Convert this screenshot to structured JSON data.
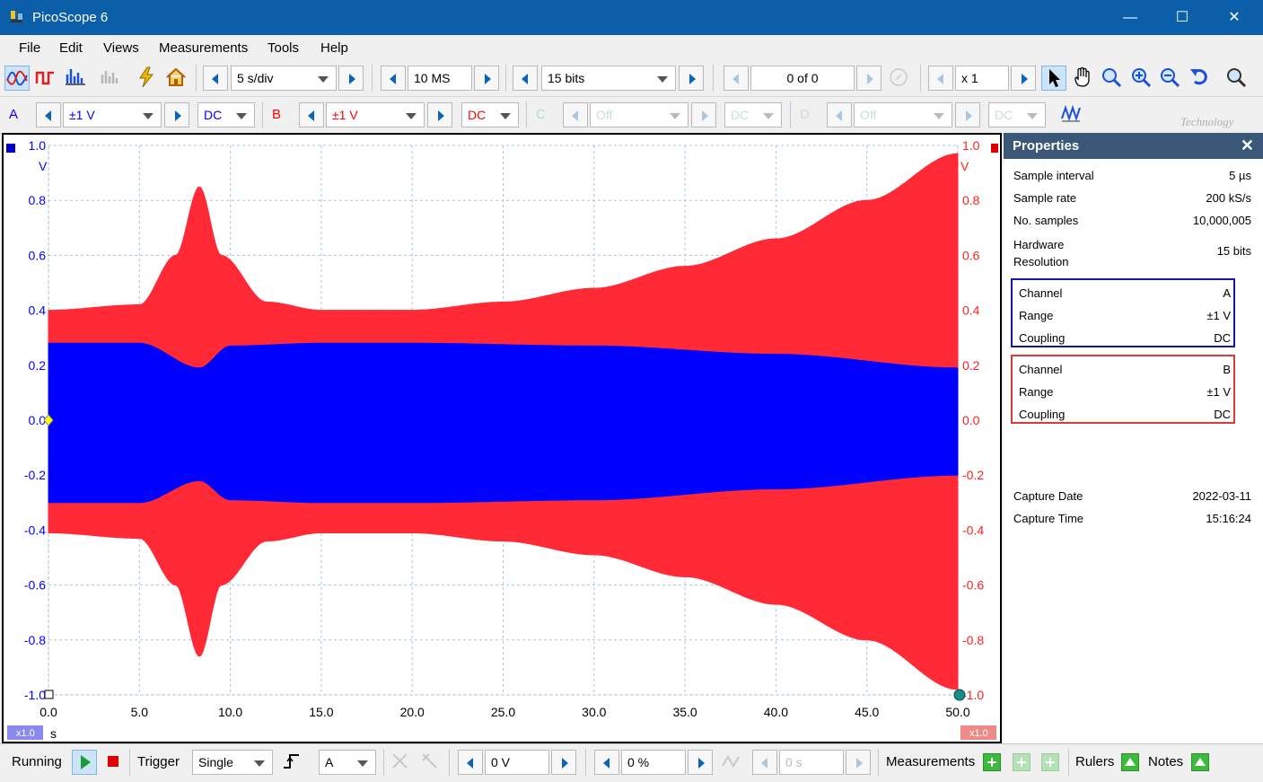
{
  "window": {
    "title": "PicoScope 6"
  },
  "menu": [
    "File",
    "Edit",
    "Views",
    "Measurements",
    "Tools",
    "Help"
  ],
  "toolbar1": {
    "timebase": "5 s/div",
    "samples": "10 MS",
    "resolution": "15 bits",
    "buffer": "0 of 0",
    "zoom": "x 1"
  },
  "toolbar2": {
    "channels": [
      {
        "label": "A",
        "range": "±1 V",
        "coupling": "DC",
        "color": "#0000ff",
        "enabled": true
      },
      {
        "label": "B",
        "range": "±1 V",
        "coupling": "DC",
        "color": "#ff0000",
        "enabled": true
      },
      {
        "label": "C",
        "range": "Off",
        "coupling": "DC",
        "color": "#9fd5c8",
        "enabled": false
      },
      {
        "label": "D",
        "range": "Off",
        "coupling": "DC",
        "color": "#d9c4a0",
        "enabled": false
      }
    ],
    "brand_text": "Technology"
  },
  "scope": {
    "left_axis_unit": "V",
    "right_axis_unit": "V",
    "x_unit": "s",
    "left_zoom_badge": "x1.0",
    "right_zoom_badge": "x1.0",
    "colors": {
      "A": "#0000ff",
      "B": "#ff2a35",
      "grid": "#a9c6de"
    }
  },
  "chart_data": {
    "type": "area",
    "xlim": [
      0,
      50
    ],
    "ylim": [
      -1,
      1
    ],
    "x_ticks": [
      "0.0",
      "5.0",
      "10.0",
      "15.0",
      "20.0",
      "25.0",
      "30.0",
      "35.0",
      "40.0",
      "45.0",
      "50.0"
    ],
    "y_ticks_left": [
      "1.0",
      "0.8",
      "0.6",
      "0.4",
      "0.2",
      "0.0",
      "-0.2",
      "-0.4",
      "-0.6",
      "-0.8",
      "-1.0"
    ],
    "y_ticks_right": [
      "1.0",
      "0.8",
      "0.6",
      "0.4",
      "0.2",
      "0.0",
      "-0.2",
      "-0.4",
      "-0.6",
      "-0.8",
      "-1.0"
    ],
    "grid": true,
    "series": [
      {
        "name": "A",
        "x": [
          0,
          5,
          8.3,
          10,
          15,
          20,
          30,
          40,
          50
        ],
        "upper": [
          0.28,
          0.28,
          0.19,
          0.27,
          0.28,
          0.28,
          0.27,
          0.24,
          0.19
        ],
        "lower": [
          -0.3,
          -0.3,
          -0.22,
          -0.29,
          -0.3,
          -0.3,
          -0.29,
          -0.25,
          -0.2
        ]
      },
      {
        "name": "B",
        "x": [
          0,
          5,
          7,
          8.3,
          9.5,
          12,
          15,
          20,
          25,
          30,
          35,
          40,
          45,
          50
        ],
        "upper": [
          0.4,
          0.42,
          0.6,
          0.85,
          0.6,
          0.43,
          0.4,
          0.4,
          0.43,
          0.48,
          0.56,
          0.66,
          0.8,
          0.97
        ],
        "lower": [
          -0.41,
          -0.43,
          -0.6,
          -0.86,
          -0.6,
          -0.44,
          -0.41,
          -0.41,
          -0.44,
          -0.49,
          -0.57,
          -0.67,
          -0.8,
          -0.98
        ]
      }
    ]
  },
  "properties": {
    "title": "Properties",
    "rows": [
      {
        "label": "Sample interval",
        "value": "5 µs"
      },
      {
        "label": "Sample rate",
        "value": "200 kS/s"
      },
      {
        "label": "No. samples",
        "value": "10,000,005"
      },
      {
        "label": "Hardware\nResolution",
        "value": "15 bits"
      }
    ],
    "channel_a": {
      "color": "#1515a8",
      "rows": [
        {
          "label": "Channel",
          "value": "A"
        },
        {
          "label": "Range",
          "value": "±1 V"
        },
        {
          "label": "Coupling",
          "value": "DC"
        }
      ]
    },
    "channel_b": {
      "color": "#d93a3a",
      "rows": [
        {
          "label": "Channel",
          "value": "B"
        },
        {
          "label": "Range",
          "value": "±1 V"
        },
        {
          "label": "Coupling",
          "value": "DC"
        }
      ]
    },
    "capture": [
      {
        "label": "Capture Date",
        "value": "2022-03-11"
      },
      {
        "label": "Capture Time",
        "value": "15:16:24"
      }
    ]
  },
  "status": {
    "running": "Running",
    "trigger_label": "Trigger",
    "trigger_mode": "Single",
    "trigger_source": "A",
    "threshold": "0 V",
    "pretrigger": "0 %",
    "delay": "0 s",
    "measurements": "Measurements",
    "rulers": "Rulers",
    "notes": "Notes"
  }
}
